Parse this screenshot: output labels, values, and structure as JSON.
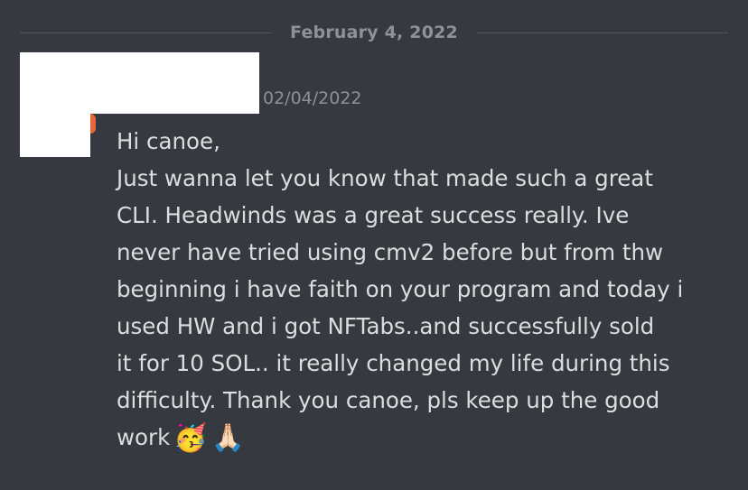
{
  "divider": {
    "date": "February 4, 2022"
  },
  "message": {
    "timestamp": "02/04/2022",
    "lines": [
      "Hi canoe,",
      "Just wanna let you know that made such a great",
      "CLI. Headwinds was a great success really. Ive",
      "never have tried using cmv2 before but from thw",
      "beginning i have faith on your program and today i",
      "used HW and i got NFTabs..and successfully sold",
      "it for 10 SOL.. it really changed my life during this",
      "difficulty. Thank you canoe, pls keep up the good",
      "work"
    ],
    "emojis": {
      "party": "🥳",
      "pray": "🙏🏻"
    }
  },
  "colors": {
    "background": "#36393f",
    "message_text": "#dcddde",
    "muted_text": "#8e9297",
    "divider_line": "#4f545c",
    "redaction": "#ffffff"
  }
}
